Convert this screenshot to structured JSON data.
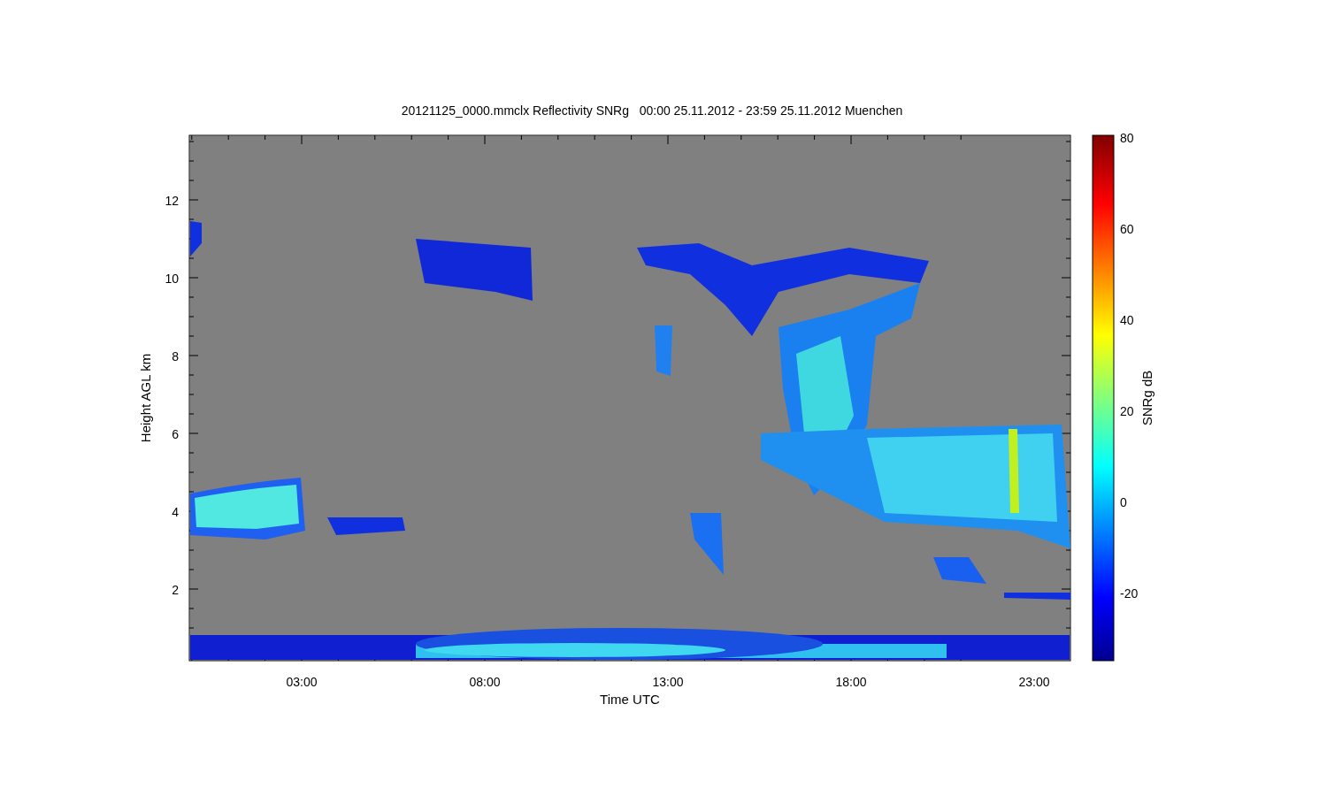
{
  "title": "20121125_0000.mmclx Reflectivity SNRg   00:00 25.11.2012 - 23:59 25.11.2012 Muenchen",
  "y_axis": {
    "label": "Height AGL km",
    "ticks": [
      "12",
      "10",
      "8",
      "6",
      "4",
      "2"
    ]
  },
  "x_axis": {
    "label": "Time UTC",
    "ticks": [
      "03:00",
      "08:00",
      "13:00",
      "18:00",
      "23:00"
    ]
  },
  "colorbar": {
    "label": "SNRg dB",
    "ticks": [
      "80",
      "60",
      "40",
      "20",
      "0",
      "-20"
    ]
  }
}
